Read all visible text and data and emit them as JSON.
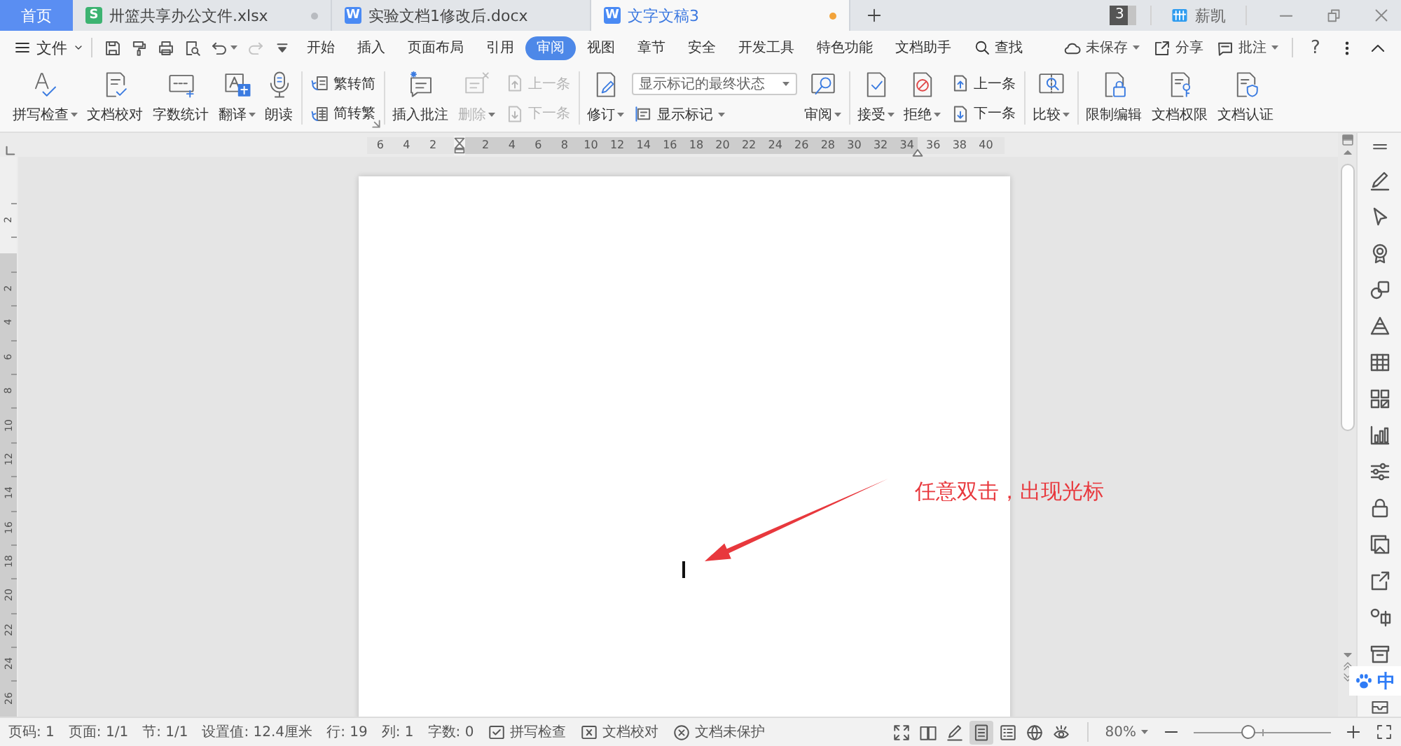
{
  "doc_tabs": [
    {
      "kind": "home",
      "label": "首页",
      "selected": false
    },
    {
      "kind": "file",
      "label": "卅篮共享办公文件.xlsx",
      "icon_letter": "S",
      "color": "#3cb371",
      "selected": false,
      "modified": true
    },
    {
      "kind": "file",
      "label": "实验文档1修改后.docx",
      "icon_letter": "W",
      "color": "#4a8af4",
      "selected": false,
      "modified": false
    },
    {
      "kind": "file",
      "label": "文字文稿3",
      "icon_letter": "W",
      "color": "#4a8af4",
      "selected": true,
      "modified": true
    }
  ],
  "title_bar": {
    "tab_count": "3",
    "user": "薪凯"
  },
  "menu": {
    "file": "文件",
    "quick_access": [
      {
        "disabled": false,
        "caret": false
      },
      {
        "disabled": false,
        "caret": false
      },
      {
        "disabled": false,
        "caret": false
      },
      {
        "disabled": false,
        "caret": false
      },
      {
        "disabled": false,
        "caret": true
      },
      {
        "disabled": true,
        "caret": false
      },
      {
        "disabled": false,
        "caret": false
      }
    ],
    "tabs": [
      {
        "label": "开始",
        "selected": false
      },
      {
        "label": "插入",
        "selected": false
      },
      {
        "label": "页面布局",
        "selected": false
      },
      {
        "label": "引用",
        "selected": false
      },
      {
        "label": "审阅",
        "selected": true
      },
      {
        "label": "视图",
        "selected": false
      },
      {
        "label": "章节",
        "selected": false
      },
      {
        "label": "安全",
        "selected": false
      },
      {
        "label": "开发工具",
        "selected": false
      },
      {
        "label": "特色功能",
        "selected": false
      },
      {
        "label": "文档助手",
        "selected": false
      }
    ],
    "find": "查找",
    "actions": [
      {
        "label": "未保存",
        "caret": true
      },
      {
        "label": "分享",
        "caret": false
      },
      {
        "label": "批注",
        "caret": true
      }
    ],
    "help": "?"
  },
  "ribbon": {
    "groups": [
      {
        "items": [
          {
            "kind": "large",
            "label": "拼写检查",
            "caret": true,
            "disabled": false
          },
          {
            "kind": "large",
            "label": "文档校对",
            "caret": false,
            "disabled": false
          },
          {
            "kind": "large",
            "label": "字数统计",
            "caret": false,
            "disabled": false
          },
          {
            "kind": "large",
            "label": "翻译",
            "caret": true,
            "disabled": false
          },
          {
            "kind": "large",
            "label": "朗读",
            "caret": false,
            "disabled": false
          }
        ]
      },
      {
        "launcher": true,
        "items": [
          {
            "kind": "stack",
            "entries": [
              {
                "label": "繁转简",
                "disabled": false
              },
              {
                "label": "简转繁",
                "disabled": false
              }
            ]
          }
        ]
      },
      {
        "items": [
          {
            "kind": "large",
            "label": "插入批注",
            "caret": false,
            "disabled": false
          },
          {
            "kind": "large",
            "label": "删除",
            "caret": true,
            "disabled": true
          },
          {
            "kind": "stack",
            "entries": [
              {
                "label": "上一条",
                "disabled": true
              },
              {
                "label": "下一条",
                "disabled": true
              }
            ]
          }
        ]
      },
      {
        "items": [
          {
            "kind": "large",
            "label": "修订",
            "caret": true,
            "disabled": false
          },
          {
            "kind": "select-stack",
            "value": "显示标记的最终状态",
            "label": "显示标记",
            "caret": true
          },
          {
            "kind": "large",
            "label": "审阅",
            "caret": true,
            "disabled": false
          }
        ]
      },
      {
        "items": [
          {
            "kind": "large",
            "label": "接受",
            "caret": true,
            "disabled": false
          },
          {
            "kind": "large",
            "label": "拒绝",
            "caret": true,
            "disabled": false
          },
          {
            "kind": "stack",
            "entries": [
              {
                "label": "上一条",
                "disabled": false
              },
              {
                "label": "下一条",
                "disabled": false
              }
            ]
          }
        ]
      },
      {
        "items": [
          {
            "kind": "large",
            "label": "比较",
            "caret": true,
            "disabled": false
          }
        ]
      },
      {
        "items": [
          {
            "kind": "large",
            "label": "限制编辑",
            "caret": false,
            "disabled": false
          },
          {
            "kind": "large",
            "label": "文档权限",
            "caret": false,
            "disabled": false
          },
          {
            "kind": "large",
            "label": "文档认证",
            "caret": false,
            "disabled": false
          }
        ]
      }
    ]
  },
  "ruler": {
    "left_labels": [
      "6",
      "4",
      "2"
    ],
    "right_labels": [
      "2",
      "4",
      "6",
      "8",
      "10",
      "12",
      "14",
      "16",
      "18",
      "20",
      "22",
      "24",
      "26",
      "28",
      "30",
      "32",
      "34",
      "36",
      "38",
      "40"
    ]
  },
  "vertical_ruler": {
    "top_labels": [
      "2"
    ],
    "labels": [
      "2",
      "4",
      "6",
      "8",
      "10",
      "12",
      "14",
      "16",
      "18",
      "20",
      "22",
      "24",
      "26"
    ]
  },
  "document": {
    "annotation": "任意双击，出现光标"
  },
  "status_bar": {
    "items": [
      {
        "kind": "text",
        "label": "页码: 1"
      },
      {
        "kind": "text",
        "label": "页面: 1/1"
      },
      {
        "kind": "text",
        "label": "节: 1/1"
      },
      {
        "kind": "text",
        "label": "设置值: 12.4厘米"
      },
      {
        "kind": "text",
        "label": "行: 19"
      },
      {
        "kind": "text",
        "label": "列: 1"
      },
      {
        "kind": "text",
        "label": "字数: 0"
      },
      {
        "kind": "button",
        "label": "拼写检查"
      },
      {
        "kind": "button",
        "label": "文档校对"
      },
      {
        "kind": "button",
        "label": "文档未保护"
      }
    ],
    "views": [
      {
        "selected": false
      },
      {
        "selected": false
      },
      {
        "selected": false
      },
      {
        "selected": true
      },
      {
        "selected": false
      },
      {
        "selected": false
      },
      {
        "selected": false
      }
    ],
    "zoom": {
      "reading": "80%",
      "level": 0.4
    }
  },
  "ime": {
    "mode": "中"
  }
}
